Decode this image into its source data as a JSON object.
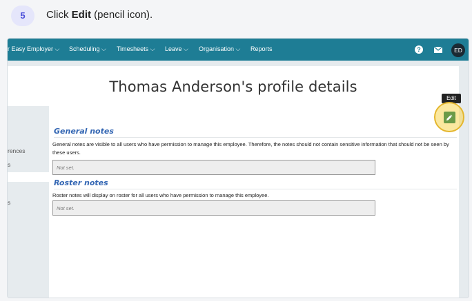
{
  "step": {
    "number": "5",
    "prefix": "Click ",
    "bold": "Edit",
    "suffix": " (pencil icon)."
  },
  "navbar": {
    "items": [
      "r Easy Employer ⌵",
      "Scheduling ⌵",
      "Timesheets ⌵",
      "Leave ⌵",
      "Organisation ⌵",
      "Reports"
    ],
    "help_icon": "question-icon",
    "mail_icon": "mail-icon",
    "avatar": "ED"
  },
  "page": {
    "title": "Thomas Anderson's profile details",
    "tooltip": "Edit",
    "edit_icon": "pencil-icon"
  },
  "sidebar": {
    "items": [
      "rences",
      "s",
      "s"
    ]
  },
  "general_notes": {
    "heading": "General notes",
    "description": "General notes are visible to all users who have permission to manage this employee. Therefore, the notes should not contain sensitive information that should not be seen by these users.",
    "value": "Not set."
  },
  "roster_notes": {
    "heading": "Roster notes",
    "description": "Roster notes will display on roster for all users who have permission to manage this employee.",
    "value": "Not set."
  },
  "colors": {
    "navbar": "#1e7d95",
    "heading": "#3366b3",
    "edit_button": "#6b9a47",
    "highlight": "#f7d650",
    "badge_bg": "#e5e6fb",
    "badge_text": "#4c4fd9"
  }
}
